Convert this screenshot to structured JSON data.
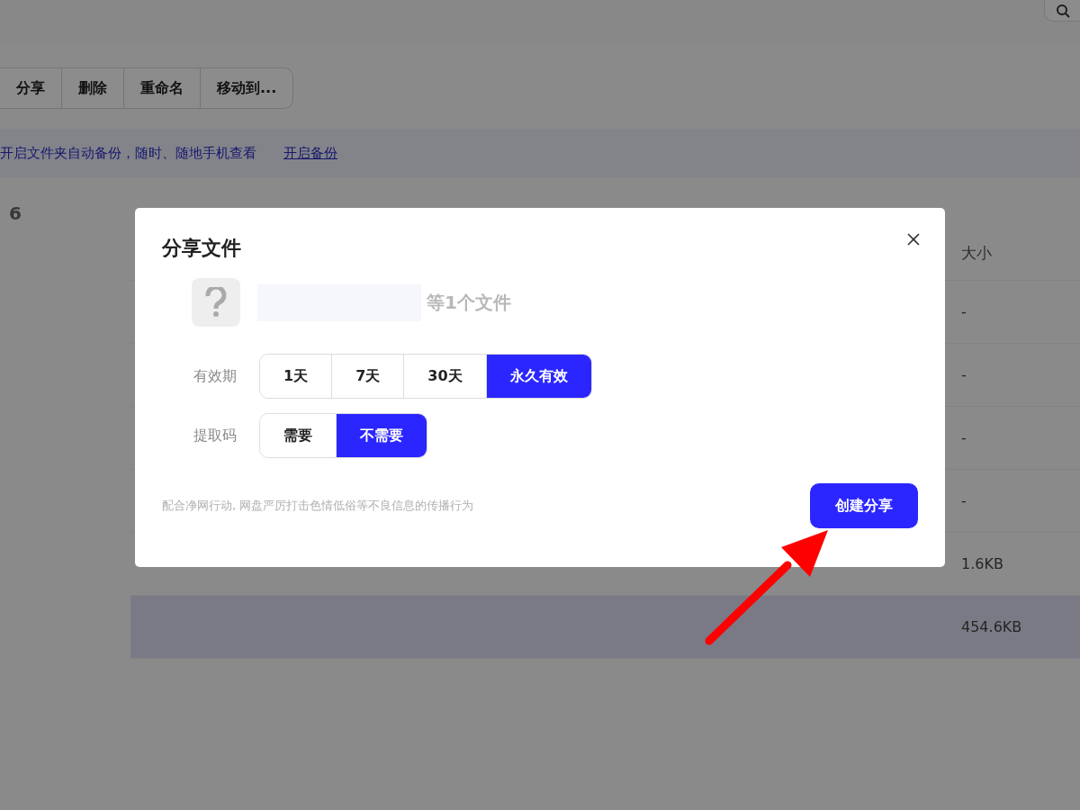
{
  "toolbar": {
    "buttons": [
      "分享",
      "删除",
      "重命名",
      "移动到..."
    ]
  },
  "banner": {
    "text": "开启文件夹自动备份，随时、随地手机查看",
    "link": "开启备份"
  },
  "file_count": "6",
  "table": {
    "columns": [
      "大小"
    ],
    "rows": [
      {
        "size": "-",
        "selected": false
      },
      {
        "size": "-",
        "selected": false
      },
      {
        "size": "-",
        "selected": false
      },
      {
        "size": "-",
        "selected": false
      },
      {
        "size": "1.6KB",
        "selected": false
      },
      {
        "size": "454.6KB",
        "selected": true
      }
    ]
  },
  "dialog": {
    "title": "分享文件",
    "file_summary": "等1个文件",
    "settings": [
      {
        "label": "有效期",
        "options": [
          {
            "label": "1天",
            "selected": false
          },
          {
            "label": "7天",
            "selected": false
          },
          {
            "label": "30天",
            "selected": false
          },
          {
            "label": "永久有效",
            "selected": true
          }
        ]
      },
      {
        "label": "提取码",
        "options": [
          {
            "label": "需要",
            "selected": false
          },
          {
            "label": "不需要",
            "selected": true
          }
        ]
      }
    ],
    "notice": "配合净网行动, 网盘严厉打击色情低俗等不良信息的传播行为",
    "create_button": "创建分享"
  }
}
